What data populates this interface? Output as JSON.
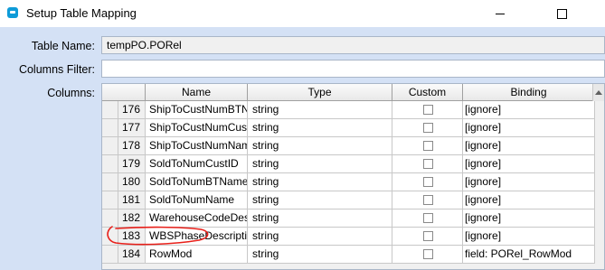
{
  "window": {
    "title": "Setup Table Mapping"
  },
  "form": {
    "table_name_label": "Table Name:",
    "table_name_value": "tempPO.PORel",
    "columns_filter_label": "Columns Filter:",
    "columns_filter_value": "",
    "columns_label": "Columns:"
  },
  "grid": {
    "headers": {
      "name": "Name",
      "type": "Type",
      "custom": "Custom",
      "binding": "Binding"
    },
    "rows": [
      {
        "num": "176",
        "name": "ShipToCustNumBTN",
        "type": "string",
        "custom": false,
        "binding": "[ignore]"
      },
      {
        "num": "177",
        "name": "ShipToCustNumCust",
        "type": "string",
        "custom": false,
        "binding": "[ignore]"
      },
      {
        "num": "178",
        "name": "ShipToCustNumNam",
        "type": "string",
        "custom": false,
        "binding": "[ignore]"
      },
      {
        "num": "179",
        "name": "SoldToNumCustID",
        "type": "string",
        "custom": false,
        "binding": "[ignore]"
      },
      {
        "num": "180",
        "name": "SoldToNumBTName",
        "type": "string",
        "custom": false,
        "binding": "[ignore]"
      },
      {
        "num": "181",
        "name": "SoldToNumName",
        "type": "string",
        "custom": false,
        "binding": "[ignore]"
      },
      {
        "num": "182",
        "name": "WarehouseCodeDes",
        "type": "string",
        "custom": false,
        "binding": "[ignore]"
      },
      {
        "num": "183",
        "name": "WBSPhaseDescripti",
        "type": "string",
        "custom": false,
        "binding": "[ignore]"
      },
      {
        "num": "184",
        "name": "RowMod",
        "type": "string",
        "custom": false,
        "binding": "field: PORel_RowMod"
      }
    ]
  },
  "colors": {
    "form_bg": "#d4e1f5",
    "annotation": "#e8201a",
    "app_icon": "#0e9bd8"
  }
}
